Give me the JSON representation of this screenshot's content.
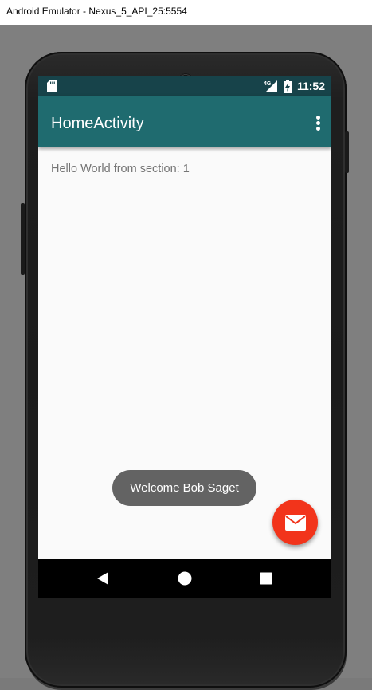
{
  "window": {
    "title": "Android Emulator - Nexus_5_API_25:5554"
  },
  "statusbar": {
    "time": "11:52",
    "network_label": "4G",
    "icons": [
      "sd-card-icon",
      "signal-icon",
      "battery-icon"
    ]
  },
  "appbar": {
    "title": "HomeActivity",
    "overflow_icon": "more-vert-icon"
  },
  "content": {
    "section_text": "Hello World from section: 1"
  },
  "toast": {
    "message": "Welcome Bob Saget"
  },
  "fab": {
    "icon": "mail-icon"
  },
  "navbar": {
    "buttons": [
      "back-icon",
      "home-icon",
      "recents-icon"
    ]
  },
  "colors": {
    "statusbar": "#17434a",
    "appbar": "#1f6b6f",
    "fab": "#f2341b",
    "toast": "#636363",
    "screen_bg": "#fafafa"
  }
}
